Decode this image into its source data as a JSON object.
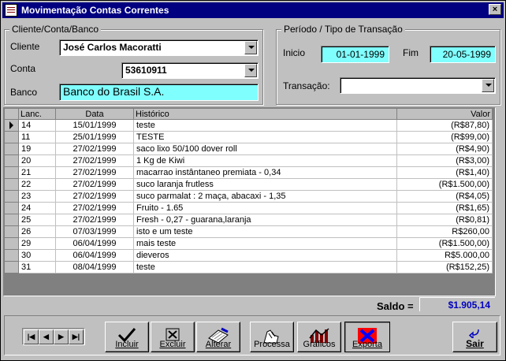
{
  "window": {
    "title": "Movimentação Contas Correntes",
    "close_glyph": "×"
  },
  "cliente_group": {
    "legend": "Cliente/Conta/Banco",
    "cliente_label": "Cliente",
    "cliente_value": "José Carlos Macoratti",
    "conta_label": "Conta",
    "conta_value": "53610911",
    "banco_label": "Banco",
    "banco_value": "Banco do Brasil S.A."
  },
  "periodo_group": {
    "legend": "Período / Tipo de Transação",
    "inicio_label": "Inicio",
    "inicio_value": "01-01-1999",
    "fim_label": "Fim",
    "fim_value": "20-05-1999",
    "transacao_label": "Transação:",
    "transacao_value": ""
  },
  "grid": {
    "columns": [
      "Lanc.",
      "Data",
      "Histórico",
      "Valor"
    ],
    "rows": [
      {
        "lanc": "14",
        "data": "15/01/1999",
        "historico": "teste",
        "valor": "(R$87,80)"
      },
      {
        "lanc": "11",
        "data": "25/01/1999",
        "historico": "TESTE",
        "valor": "(R$99,00)"
      },
      {
        "lanc": "19",
        "data": "27/02/1999",
        "historico": "saco lixo 50/100 dover roll",
        "valor": "(R$4,90)"
      },
      {
        "lanc": "20",
        "data": "27/02/1999",
        "historico": "1 Kg de Kiwi",
        "valor": "(R$3,00)"
      },
      {
        "lanc": "21",
        "data": "27/02/1999",
        "historico": "macarrao instântaneo premiata - 0,34",
        "valor": "(R$1,40)"
      },
      {
        "lanc": "22",
        "data": "27/02/1999",
        "historico": "suco laranja frutless",
        "valor": "(R$1.500,00)"
      },
      {
        "lanc": "23",
        "data": "27/02/1999",
        "historico": "suco parmalat : 2 maça, abacaxi - 1,35",
        "valor": "(R$4,05)"
      },
      {
        "lanc": "24",
        "data": "27/02/1999",
        "historico": "Fruito - 1.65",
        "valor": "(R$1,65)"
      },
      {
        "lanc": "25",
        "data": "27/02/1999",
        "historico": "Fresh - 0,27 - guarana,laranja",
        "valor": "(R$0,81)"
      },
      {
        "lanc": "26",
        "data": "07/03/1999",
        "historico": "isto e um teste",
        "valor": "R$260,00"
      },
      {
        "lanc": "29",
        "data": "06/04/1999",
        "historico": "mais teste",
        "valor": "(R$1.500,00)"
      },
      {
        "lanc": "30",
        "data": "06/04/1999",
        "historico": "dieveros",
        "valor": "R$5.000,00"
      },
      {
        "lanc": "31",
        "data": "08/04/1999",
        "historico": "teste",
        "valor": "(R$152,25)"
      }
    ]
  },
  "saldo": {
    "label": "Saldo =",
    "value": "$1.905,14"
  },
  "toolbar": {
    "nav": [
      "|◀",
      "◀",
      "▶",
      "▶|"
    ],
    "incluir": "Incluir",
    "excluir": "Excluir",
    "alterar": "Alterar",
    "processa": "Processa",
    "graficos": "Gráficos",
    "exporta": "Exporta",
    "sair": "Sair"
  },
  "colors": {
    "title_bar": "#000080",
    "highlight_field": "#80ffff",
    "saldo_text": "#0000c0"
  }
}
